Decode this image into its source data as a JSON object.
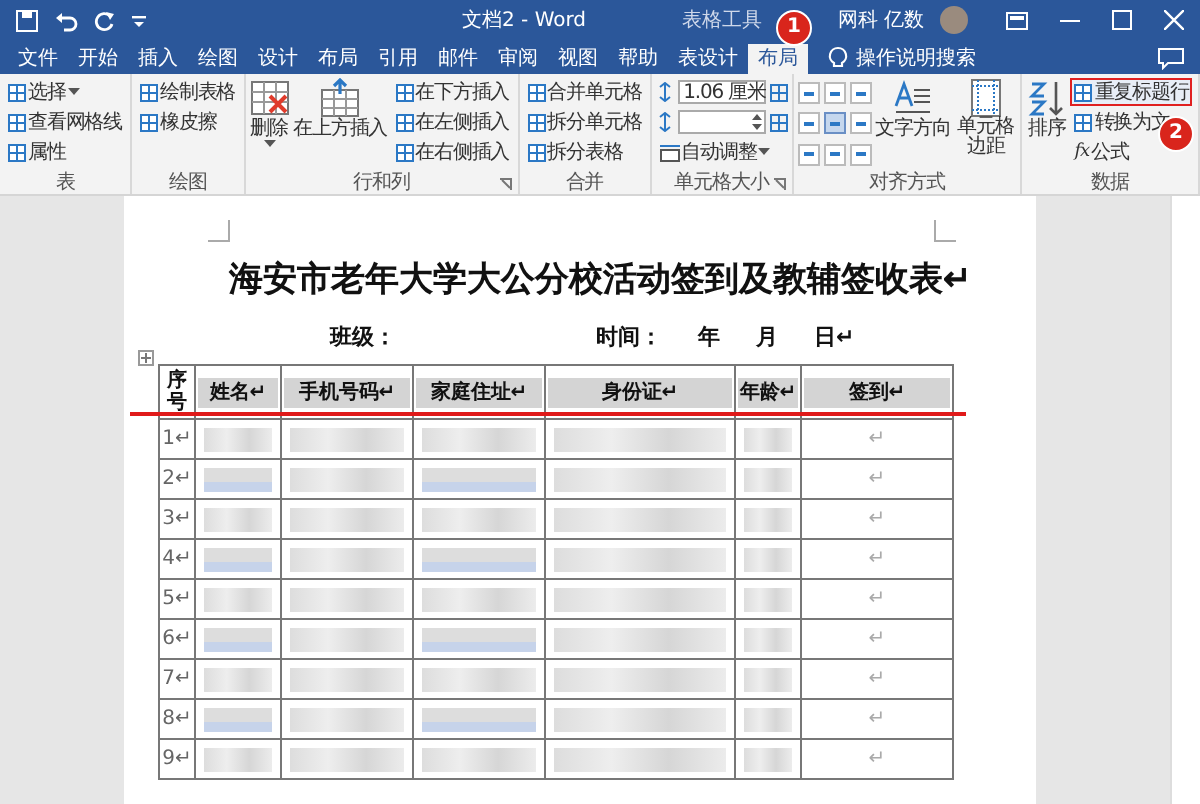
{
  "window": {
    "title": "文档2 - Word",
    "context_tab_title": "表格工具",
    "user": "网科 亿数"
  },
  "tabs": [
    {
      "label": "文件",
      "selected": false
    },
    {
      "label": "开始",
      "selected": false
    },
    {
      "label": "插入",
      "selected": false
    },
    {
      "label": "绘图",
      "selected": false
    },
    {
      "label": "设计",
      "selected": false
    },
    {
      "label": "布局",
      "selected": false
    },
    {
      "label": "引用",
      "selected": false
    },
    {
      "label": "邮件",
      "selected": false
    },
    {
      "label": "审阅",
      "selected": false
    },
    {
      "label": "视图",
      "selected": false
    },
    {
      "label": "帮助",
      "selected": false
    },
    {
      "label": "表设计",
      "selected": false
    },
    {
      "label": "布局",
      "selected": true
    }
  ],
  "tell_me": {
    "placeholder": "操作说明搜索"
  },
  "ribbon": {
    "groups": [
      {
        "label": "表",
        "items": [
          {
            "kind": "stack",
            "items": [
              {
                "label": "选择",
                "dropdown": true
              },
              {
                "label": "查看网格线"
              },
              {
                "label": "属性"
              }
            ]
          }
        ]
      },
      {
        "label": "绘图",
        "items": [
          {
            "kind": "stack",
            "items": [
              {
                "label": "绘制表格"
              },
              {
                "label": "橡皮擦"
              }
            ]
          }
        ]
      },
      {
        "label": "行和列",
        "launcher": true,
        "items": [
          {
            "kind": "large",
            "label": "删除",
            "dropdown": true
          },
          {
            "kind": "large",
            "label": "在上方插入"
          },
          {
            "kind": "stack",
            "items": [
              {
                "label": "在下方插入"
              },
              {
                "label": "在左侧插入"
              },
              {
                "label": "在右侧插入"
              }
            ]
          }
        ]
      },
      {
        "label": "合并",
        "items": [
          {
            "kind": "stack",
            "items": [
              {
                "label": "合并单元格"
              },
              {
                "label": "拆分单元格"
              },
              {
                "label": "拆分表格"
              }
            ]
          }
        ]
      },
      {
        "label": "单元格大小",
        "launcher": true,
        "items": [
          {
            "kind": "size",
            "height": "1.06 厘米",
            "autofit": {
              "label": "自动调整",
              "dropdown": true
            }
          }
        ]
      },
      {
        "label": "对齐方式",
        "items": [
          {
            "kind": "align",
            "cells": [
              {
                "selected": false
              },
              {
                "selected": false
              },
              {
                "selected": false
              },
              {
                "selected": false
              },
              {
                "selected": true
              },
              {
                "selected": false
              },
              {
                "selected": false
              },
              {
                "selected": false
              },
              {
                "selected": false
              }
            ]
          },
          {
            "kind": "large",
            "label": "文字方向"
          },
          {
            "kind": "large",
            "label": "单元格边距"
          }
        ]
      },
      {
        "label": "数据",
        "items": [
          {
            "kind": "large",
            "label": "排序"
          },
          {
            "kind": "stack",
            "items": [
              {
                "label": "重复标题行",
                "highlight": true
              },
              {
                "label": "转换为文",
                "highlight": false
              },
              {
                "label": "公式",
                "highlight": false,
                "glyph": "fx"
              }
            ]
          }
        ]
      }
    ]
  },
  "document": {
    "title": "海安市老年大学大公分校活动签到及教辅签收表↵",
    "class_label": "班级：",
    "date_line": [
      {
        "text": "时间："
      },
      {
        "text": "年"
      },
      {
        "text": "月"
      },
      {
        "text": "日↵"
      }
    ],
    "table": {
      "header_marked": true,
      "columns": [
        "序号",
        "姓名↵",
        "手机号码↵",
        "家庭住址↵",
        "身份证↵",
        "年龄↵",
        "签到↵"
      ],
      "rows": [
        {
          "number": "1↵",
          "sign": "↵"
        },
        {
          "number": "2↵",
          "sign": "↵"
        },
        {
          "number": "3↵",
          "sign": "↵"
        },
        {
          "number": "4↵",
          "sign": "↵"
        },
        {
          "number": "5↵",
          "sign": "↵"
        },
        {
          "number": "6↵",
          "sign": "↵"
        },
        {
          "number": "7↵",
          "sign": "↵"
        },
        {
          "number": "8↵",
          "sign": "↵"
        },
        {
          "number": "9↵",
          "sign": "↵"
        }
      ]
    }
  },
  "badges": [
    {
      "label": "1"
    },
    {
      "label": "2"
    }
  ]
}
